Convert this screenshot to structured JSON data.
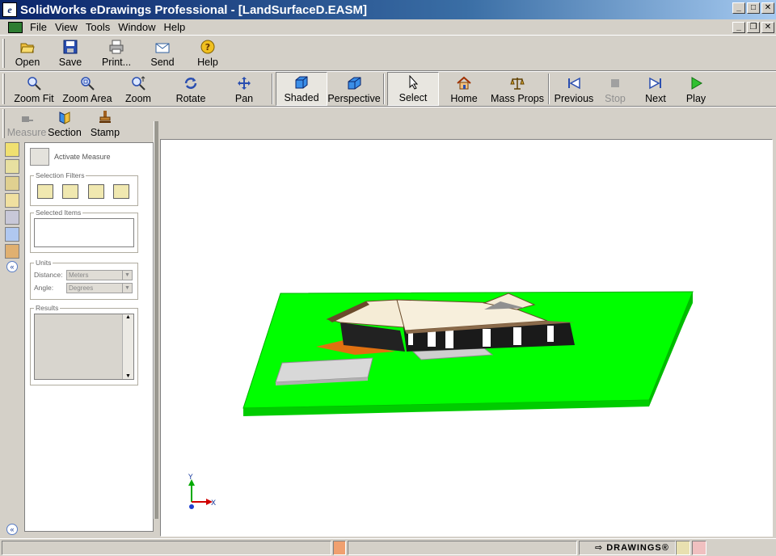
{
  "window": {
    "title": "SolidWorks eDrawings Professional - [LandSurfaceD.EASM]",
    "app_icon_glyph": "e"
  },
  "menubar": {
    "items": [
      "File",
      "View",
      "Tools",
      "Window",
      "Help"
    ]
  },
  "toolbar_main": {
    "open": "Open",
    "save": "Save",
    "print": "Print...",
    "send": "Send",
    "help": "Help"
  },
  "toolbar_view": {
    "zoom_fit": "Zoom Fit",
    "zoom_area": "Zoom Area",
    "zoom": "Zoom",
    "rotate": "Rotate",
    "pan": "Pan",
    "shaded": "Shaded",
    "perspective": "Perspective",
    "select": "Select",
    "home": "Home",
    "mass_props": "Mass Props",
    "previous": "Previous",
    "stop": "Stop",
    "next": "Next",
    "play": "Play"
  },
  "toolbar_tools": {
    "measure": "Measure",
    "section": "Section",
    "stamp": "Stamp"
  },
  "measure_panel": {
    "activate_label": "Activate Measure",
    "selection_filters_label": "Selection Filters",
    "selected_items_label": "Selected Items",
    "units_label": "Units",
    "distance_label": "Distance:",
    "distance_value": "Meters",
    "angle_label": "Angle:",
    "angle_value": "Degrees",
    "results_label": "Results"
  },
  "triad": {
    "x": "X",
    "y": "Y"
  },
  "statusbar": {
    "brand": "DRAWINGS®"
  },
  "colors": {
    "title_gradient_start": "#0a246a",
    "ground": "#00ff00",
    "roof": "#f5ecd6",
    "walls": "#202020"
  }
}
